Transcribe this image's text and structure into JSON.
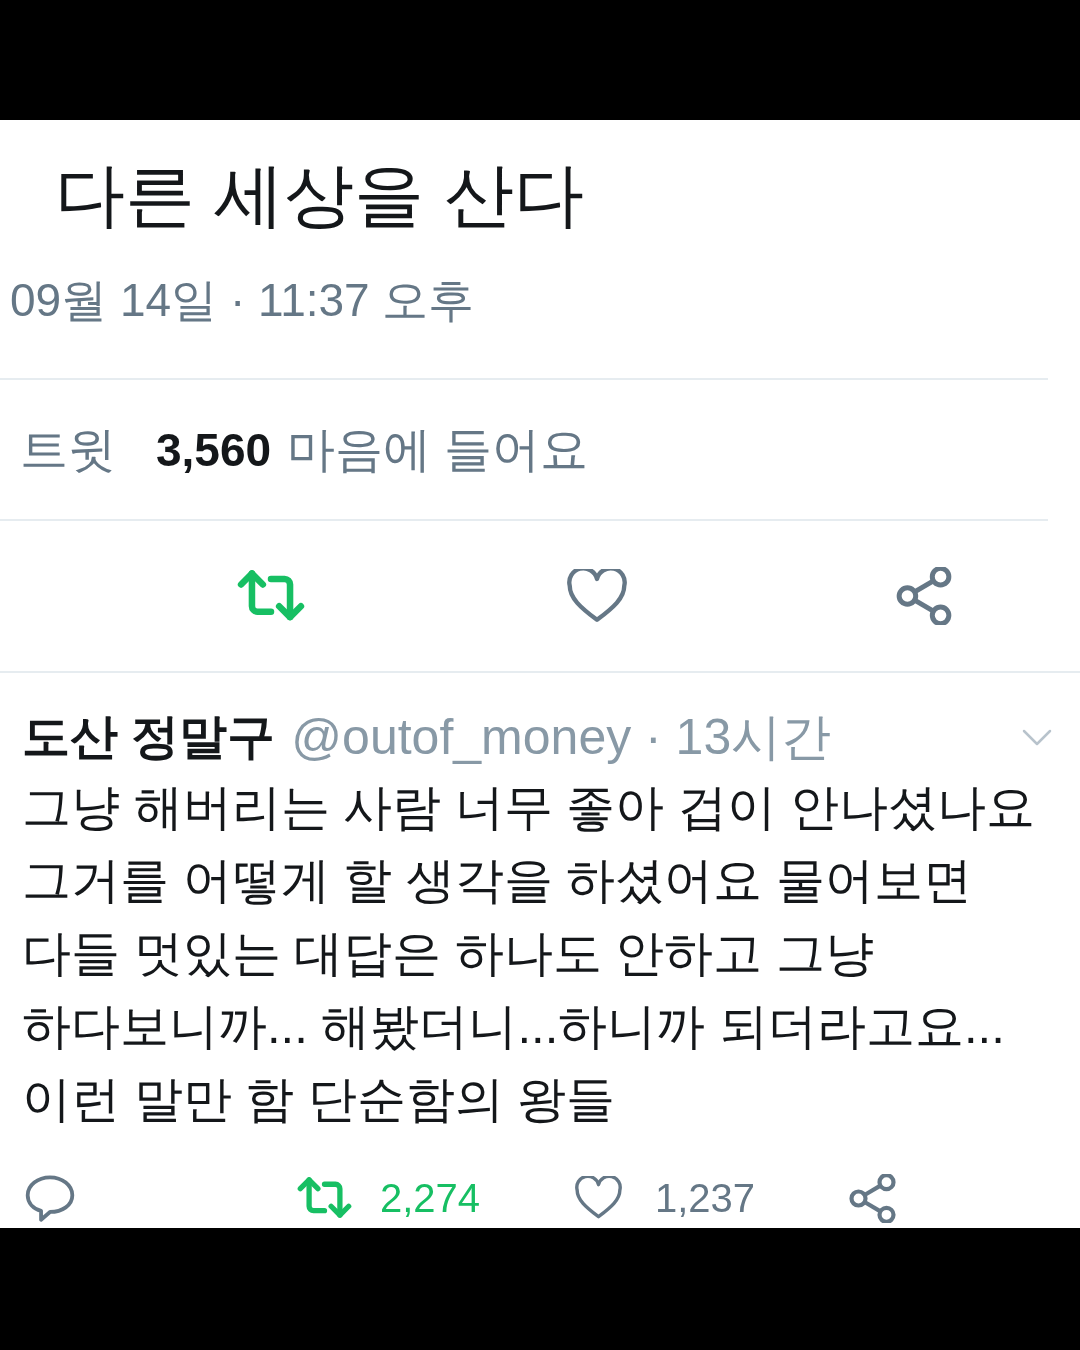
{
  "tweet": {
    "text": "다른 세상을 산다",
    "timestamp": "09월 14일 · 11:37 오후"
  },
  "stats": {
    "retweets_label": "트윗",
    "likes_count": "3,560",
    "likes_label": "마음에 들어요"
  },
  "actions": [
    {
      "kind": "retweet",
      "active": true
    },
    {
      "kind": "like",
      "active": false
    },
    {
      "kind": "share",
      "active": false
    }
  ],
  "reply": {
    "name": "도산 정말구",
    "meta": "@outof_money · 13시간",
    "text": "그냥 해버리는 사람 너무 좋아 겁이 안나셨나요\n그거를 어떻게 할 생각을 하셨어요 물어보면\n다들 멋있는 대답은 하나도 안하고 그냥\n하다보니까... 해봤더니...하니까 되더라고요...\n이런 말만 함 단순함의 왕들",
    "actions": [
      {
        "kind": "reply",
        "active": false
      },
      {
        "kind": "retweet",
        "count": "2,274",
        "active": true
      },
      {
        "kind": "like",
        "count": "1,237",
        "active": false
      },
      {
        "kind": "share",
        "active": false
      }
    ]
  }
}
